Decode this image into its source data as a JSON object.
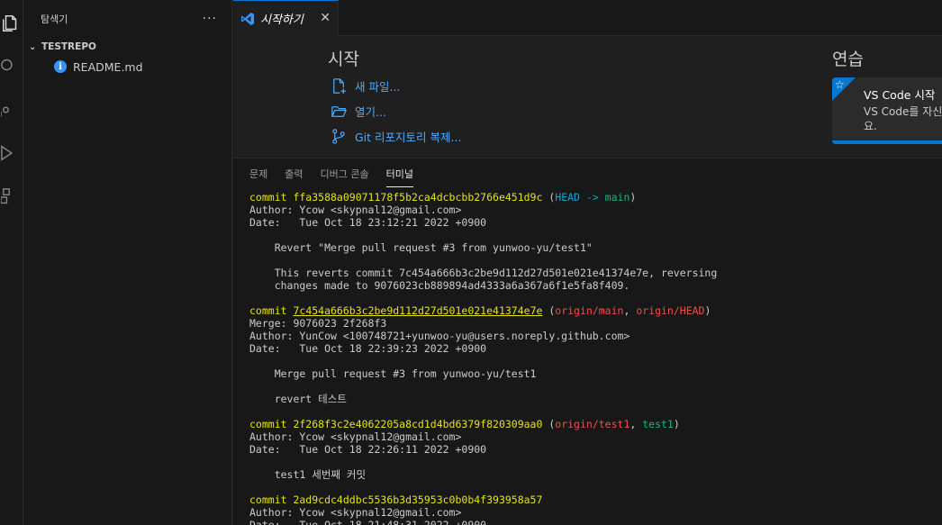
{
  "sidebar": {
    "title": "탐색기",
    "more": "···",
    "repo": "TESTREPO",
    "file": "README.md"
  },
  "tab": {
    "label": "시작하기",
    "close": "✕"
  },
  "welcome": {
    "start_title": "시작",
    "links": [
      "새 파일...",
      "열기...",
      "Git 리포지토리 복제..."
    ],
    "practice_title": "연습",
    "walkthrough_title": "VS Code 시작",
    "walkthrough_desc_1": "VS Code를 자신",
    "walkthrough_desc_2": "요."
  },
  "panel": {
    "tabs": [
      "문제",
      "출력",
      "디버그 콘솔",
      "터미널"
    ],
    "active_tab": "터미널"
  },
  "terminal": {
    "lines": [
      [
        {
          "t": "commit ffa3588a09071178f5b2ca4dcbcbb2766e451d9c",
          "c": "t-commit"
        },
        {
          "t": " ("
        },
        {
          "t": "HEAD -> ",
          "c": "t-cyan"
        },
        {
          "t": "main",
          "c": "t-green"
        },
        {
          "t": ")"
        }
      ],
      [
        {
          "t": "Author: Ycow <skypnal12@gmail.com>"
        }
      ],
      [
        {
          "t": "Date:   Tue Oct 18 23:12:21 2022 +0900"
        }
      ],
      [
        {
          "t": ""
        }
      ],
      [
        {
          "t": "    Revert \"Merge pull request #3 from yunwoo-yu/test1\""
        }
      ],
      [
        {
          "t": ""
        }
      ],
      [
        {
          "t": "    This reverts commit 7c454a666b3c2be9d112d27d501e021e41374e7e, reversing"
        }
      ],
      [
        {
          "t": "    changes made to 9076023cb889894ad4333a6a367a6f1e5fa8f409."
        }
      ],
      [
        {
          "t": ""
        }
      ],
      [
        {
          "t": "commit ",
          "c": "t-commit"
        },
        {
          "t": "7c454a666b3c2be9d112d27d501e021e41374e7e",
          "c": "t-commit-u"
        },
        {
          "t": " ("
        },
        {
          "t": "origin/main",
          "c": "t-red"
        },
        {
          "t": ", "
        },
        {
          "t": "origin/HEAD",
          "c": "t-red"
        },
        {
          "t": ")"
        }
      ],
      [
        {
          "t": "Merge: 9076023 2f268f3"
        }
      ],
      [
        {
          "t": "Author: YunCow <100748721+yunwoo-yu@users.noreply.github.com>"
        }
      ],
      [
        {
          "t": "Date:   Tue Oct 18 22:39:23 2022 +0900"
        }
      ],
      [
        {
          "t": ""
        }
      ],
      [
        {
          "t": "    Merge pull request #3 from yunwoo-yu/test1"
        }
      ],
      [
        {
          "t": ""
        }
      ],
      [
        {
          "t": "    revert 테스트"
        }
      ],
      [
        {
          "t": ""
        }
      ],
      [
        {
          "t": "commit 2f268f3c2e4062205a8cd1d4bd6379f820309aa0",
          "c": "t-commit"
        },
        {
          "t": " ("
        },
        {
          "t": "origin/test1",
          "c": "t-red"
        },
        {
          "t": ", "
        },
        {
          "t": "test1",
          "c": "t-green"
        },
        {
          "t": ")"
        }
      ],
      [
        {
          "t": "Author: Ycow <skypnal12@gmail.com>"
        }
      ],
      [
        {
          "t": "Date:   Tue Oct 18 22:26:11 2022 +0900"
        }
      ],
      [
        {
          "t": ""
        }
      ],
      [
        {
          "t": "    test1 세번째 커밋"
        }
      ],
      [
        {
          "t": ""
        }
      ],
      [
        {
          "t": "commit 2ad9cdc4ddbc5536b3d35953c0b0b4f393958a57",
          "c": "t-commit"
        }
      ],
      [
        {
          "t": "Author: Ycow <skypnal12@gmail.com>"
        }
      ],
      [
        {
          "t": "Date:   Tue Oct 18 21:48:31 2022 +0900"
        }
      ]
    ]
  }
}
